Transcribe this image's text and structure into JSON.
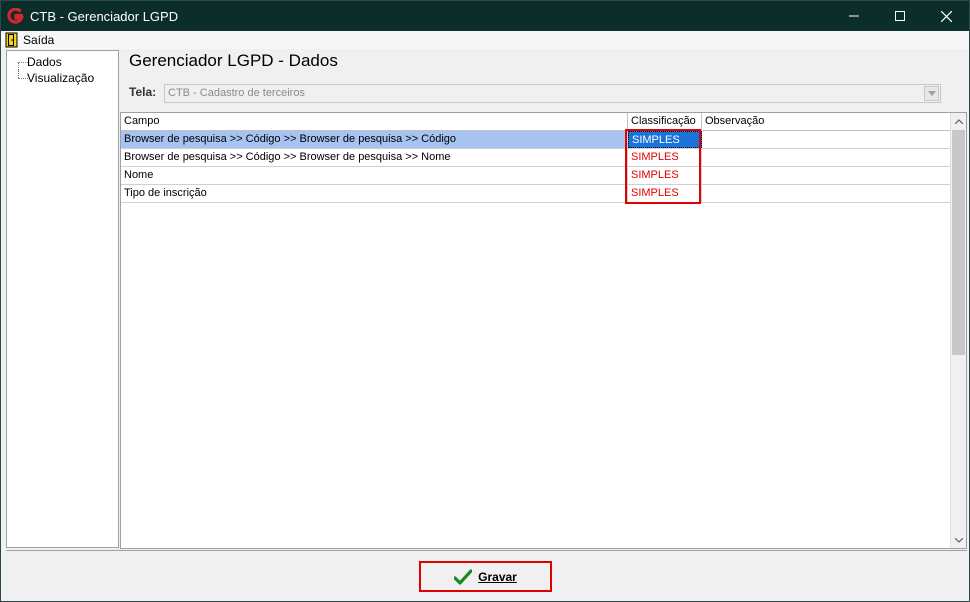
{
  "window": {
    "title": "CTB - Gerenciador LGPD"
  },
  "menu": {
    "exit_label": "Saída"
  },
  "tree": {
    "items": [
      {
        "label": "Dados"
      },
      {
        "label": "Visualização"
      }
    ]
  },
  "main": {
    "title": "Gerenciador LGPD - Dados",
    "tela_label": "Tela:",
    "tela_value": "CTB - Cadastro de terceiros"
  },
  "grid": {
    "columns": [
      "Campo",
      "Classificação",
      "Observação"
    ],
    "rows": [
      {
        "campo": "Browser de pesquisa >> Código >> Browser de pesquisa >> Código",
        "classificacao": "SIMPLES",
        "observacao": "",
        "selected": true
      },
      {
        "campo": "Browser de pesquisa >> Código >> Browser de pesquisa >> Nome",
        "classificacao": "SIMPLES",
        "observacao": ""
      },
      {
        "campo": "Nome",
        "classificacao": "SIMPLES",
        "observacao": ""
      },
      {
        "campo": "Tipo de inscrição",
        "classificacao": "SIMPLES",
        "observacao": ""
      }
    ]
  },
  "footer": {
    "save_label": "Gravar"
  },
  "colors": {
    "titlebar": "#0b2e2b",
    "highlight": "#e00000",
    "selected_row": "#a6c3f2",
    "selected_cell": "#1a73d9",
    "check_icon": "#1e8a1e"
  },
  "icons": {
    "app": "app-logo-icon",
    "exit": "exit-door-icon",
    "save": "check-icon"
  }
}
